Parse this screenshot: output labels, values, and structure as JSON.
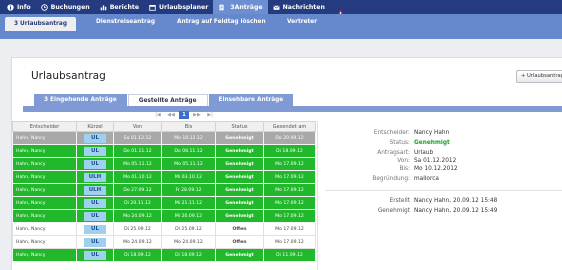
{
  "topnav": {
    "items": [
      {
        "label": "Info",
        "icon": "info-icon"
      },
      {
        "label": "Buchungen",
        "icon": "clock-icon"
      },
      {
        "label": "Berichte",
        "icon": "chart-icon"
      },
      {
        "label": "Urlaubsplaner",
        "icon": "calendar-icon"
      },
      {
        "label": "Anträge",
        "icon": "document-icon",
        "badge": "3"
      },
      {
        "label": "Nachrichten",
        "icon": "mail-icon"
      }
    ],
    "warning_icon": "warning-icon"
  },
  "subnav": {
    "items": [
      {
        "label": "3 Urlaubsantrag"
      },
      {
        "label": "Dienstreiseantrag"
      },
      {
        "label": "Antrag auf Feldtag löschen"
      },
      {
        "label": "Vertreter"
      }
    ]
  },
  "panel": {
    "title": "Urlaubsantrag",
    "add_button": "+ Urlaubsantrag"
  },
  "tabs": [
    {
      "label": "3 Eingehende Anträge"
    },
    {
      "label": "Gestellte Anträge"
    },
    {
      "label": "Einsehbare Anträge"
    }
  ],
  "pager": {
    "first": "|◀",
    "prev": "◀◀",
    "current": "1",
    "next": "▶▶",
    "last": "▶|"
  },
  "table": {
    "headers": [
      "Entscheider",
      "Kürzel",
      "Von",
      "Bis",
      "Status",
      "Gesendet am"
    ],
    "rows": [
      {
        "entscheider": "Hahn, Nancy",
        "kuerzel": "UL",
        "von": "Sa 01.12.12",
        "bis": "Mo 10.12.12",
        "status": "Genehmigt",
        "gesendet": "Do 20.09.12",
        "style": "gray"
      },
      {
        "entscheider": "Hahn, Nancy",
        "kuerzel": "UL",
        "von": "Do 01.11.12",
        "bis": "Do 08.11.12",
        "status": "Genehmigt",
        "gesendet": "Di 18.09.12",
        "style": "green"
      },
      {
        "entscheider": "Hahn, Nancy",
        "kuerzel": "UL",
        "von": "Mo 05.11.12",
        "bis": "Mo 05.11.12",
        "status": "Genehmigt",
        "gesendet": "Mo 17.09.12",
        "style": "green"
      },
      {
        "entscheider": "Hahn, Nancy",
        "kuerzel": "ULH",
        "von": "Mo 01.10.12",
        "bis": "Mi 03.10.12",
        "status": "Genehmigt",
        "gesendet": "Mo 17.09.12",
        "style": "green"
      },
      {
        "entscheider": "Hahn, Nancy",
        "kuerzel": "ULH",
        "von": "Do 27.09.12",
        "bis": "Fr 28.09.12",
        "status": "Genehmigt",
        "gesendet": "Mo 17.09.12",
        "style": "green"
      },
      {
        "entscheider": "Hahn, Nancy",
        "kuerzel": "UL",
        "von": "Di 20.11.12",
        "bis": "Mi 21.11.12",
        "status": "Genehmigt",
        "gesendet": "Mo 17.09.12",
        "style": "green"
      },
      {
        "entscheider": "Hahn, Nancy",
        "kuerzel": "UL",
        "von": "Mo 24.09.12",
        "bis": "Mi 26.09.12",
        "status": "Genehmigt",
        "gesendet": "Mo 17.09.12",
        "style": "green"
      },
      {
        "entscheider": "Hahn, Nancy",
        "kuerzel": "UL",
        "von": "Di 25.09.12",
        "bis": "Di 25.09.12",
        "status": "Offen",
        "gesendet": "Mo 17.09.12",
        "style": "white"
      },
      {
        "entscheider": "Hahn, Nancy",
        "kuerzel": "UL",
        "von": "Mo 24.09.12",
        "bis": "Mo 24.09.12",
        "status": "Offen",
        "gesendet": "Mo 17.09.12",
        "style": "white"
      },
      {
        "entscheider": "Hahn, Nancy",
        "kuerzel": "UL",
        "von": "Di 18.09.12",
        "bis": "Di 18.09.12",
        "status": "Genehmigt",
        "gesendet": "Di 11.09.12",
        "style": "green"
      }
    ]
  },
  "details": {
    "entscheider_label": "Entscheider:",
    "entscheider": "Nancy Hahn",
    "status_label": "Status:",
    "status": "Genehmigt",
    "antragsart_label": "Antragsart:",
    "antragsart": "Urlaub",
    "von_label": "Von:",
    "von": "Sa 01.12.2012",
    "bis_label": "Bis:",
    "bis": "Mo 10.12.2012",
    "begruendung_label": "Begründung:",
    "begruendung": "mallorca",
    "erstellt_label": "Erstellt",
    "erstellt": "Nancy Hahn, 20.09.12 15:48",
    "genehmigt_label": "Genehmigt",
    "genehmigt": "Nancy Hahn, 20.09.12 15:49"
  },
  "colors": {
    "nav_bg": "#243b80",
    "subnav_bg": "#6688cc",
    "approved_row": "#22b82c",
    "selected_row": "#a9a9a9",
    "kuerzel_badge": "#9fd1ee",
    "status_green": "#1aa324"
  }
}
